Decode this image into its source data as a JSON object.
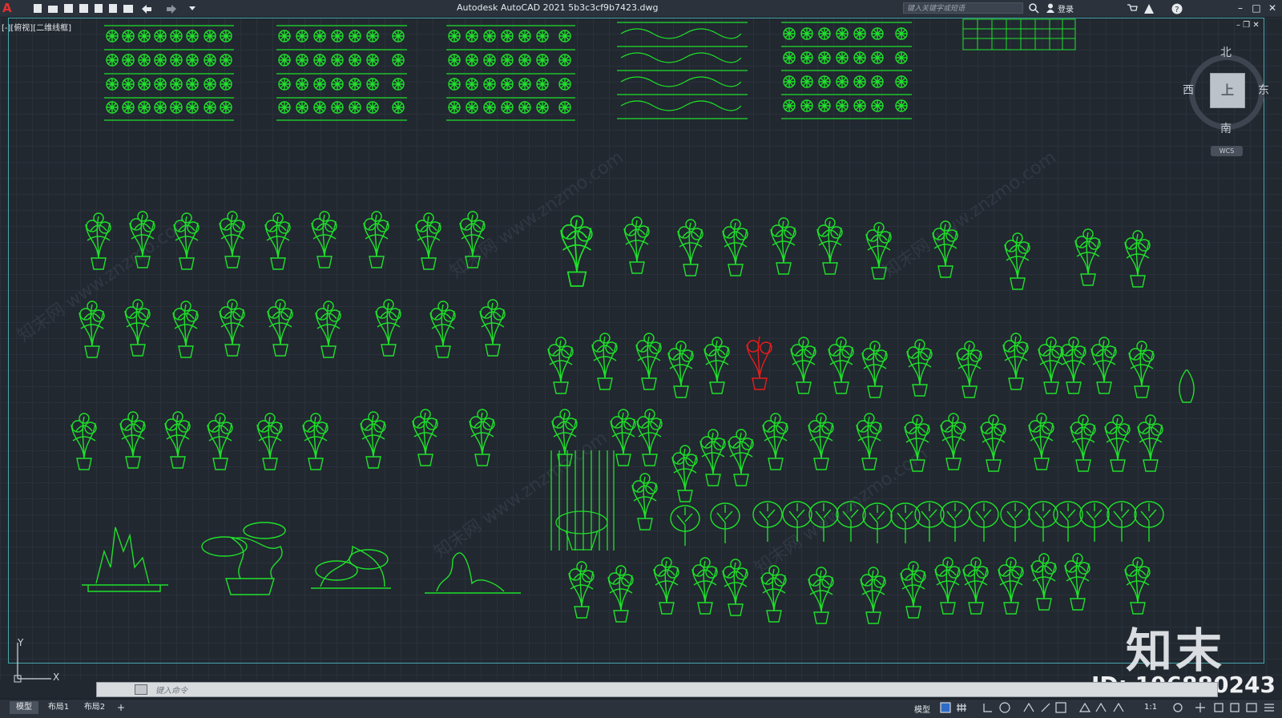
{
  "app": {
    "logo": "A",
    "title": "Autodesk AutoCAD 2021    5b3c3cf9b7423.dwg",
    "search_placeholder": "键入关键字或短语",
    "login": "登录"
  },
  "viewport": {
    "label": "[-][俯视][二维线框]",
    "controls": "– ❐ ✕"
  },
  "viewcube": {
    "face": "上",
    "north": "北",
    "south": "南",
    "east": "东",
    "west": "西",
    "wcs": "WCS"
  },
  "ucs": {
    "x": "X",
    "y": "Y"
  },
  "watermark": {
    "brand": "知末",
    "id": "ID: 196880243",
    "diagonal": "知末网 www.znzmo.com"
  },
  "command": {
    "placeholder": "键入命令"
  },
  "status": {
    "tabs": [
      "模型",
      "布局1",
      "布局2",
      "+"
    ],
    "model": "模型",
    "scale": "1:1"
  },
  "colors": {
    "plant_green": "#1fe02a",
    "plant_cyan": "#3fd5e0",
    "plant_red": "#e81c1c",
    "frame": "#4aa7ad"
  }
}
